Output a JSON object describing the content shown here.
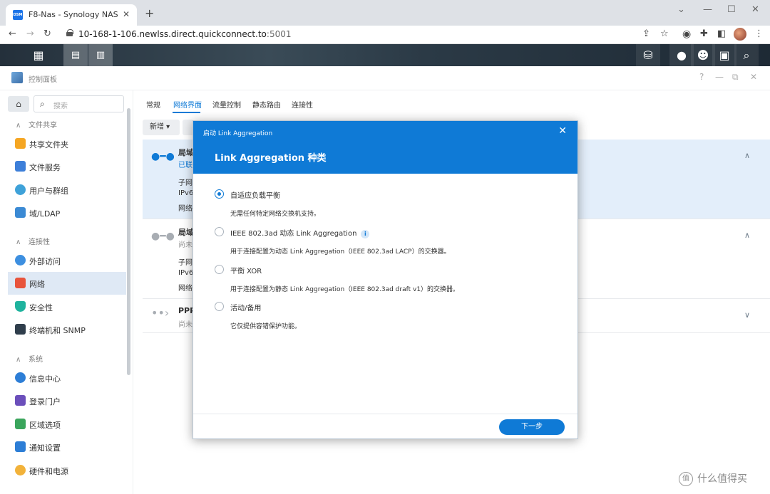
{
  "browser": {
    "tab_title": "F8-Nas - Synology NAS",
    "favicon_text": "DSM",
    "url_host": "10-168-1-106.newlss.direct.quickconnect.to",
    "url_port": ":5001"
  },
  "window": {
    "title": "控制面板",
    "controls": [
      "?",
      "—",
      "⧉",
      "✕"
    ]
  },
  "sidebar": {
    "search_placeholder": "搜索",
    "sections": {
      "file_sharing": "文件共享",
      "connectivity": "连接性",
      "system": "系统"
    },
    "items": [
      {
        "label": "共享文件夹",
        "icon": "shared-folder-icon",
        "color": "#f5a623"
      },
      {
        "label": "文件服务",
        "icon": "file-services-icon",
        "color": "#3d7fd9"
      },
      {
        "label": "用户与群组",
        "icon": "users-groups-icon",
        "color": "#3fa2d9"
      },
      {
        "label": "域/LDAP",
        "icon": "domain-ldap-icon",
        "color": "#3b8ad4"
      },
      {
        "label": "外部访问",
        "icon": "external-access-icon",
        "color": "#3d8fe0"
      },
      {
        "label": "网络",
        "icon": "network-icon",
        "color": "#e8543c"
      },
      {
        "label": "安全性",
        "icon": "security-icon",
        "color": "#1fb39e"
      },
      {
        "label": "终端机和 SNMP",
        "icon": "terminal-snmp-icon",
        "color": "#2f3e4c"
      },
      {
        "label": "信息中心",
        "icon": "info-center-icon",
        "color": "#2d7ed6"
      },
      {
        "label": "登录门户",
        "icon": "login-portal-icon",
        "color": "#6b4fbb"
      },
      {
        "label": "区域选项",
        "icon": "regional-options-icon",
        "color": "#3aa55c"
      },
      {
        "label": "通知设置",
        "icon": "notification-icon",
        "color": "#2d7ed6"
      },
      {
        "label": "硬件和电源",
        "icon": "hardware-power-icon",
        "color": "#f2b23a"
      }
    ]
  },
  "tabs": [
    "常规",
    "网络界面",
    "流量控制",
    "静态路由",
    "连接性"
  ],
  "toolbar": {
    "add_label": "新增 ▾"
  },
  "interfaces": [
    {
      "name": "局域",
      "status": "已联",
      "status_color": "#0f7ad6",
      "lines": [
        "子网",
        "IPv6",
        "网络"
      ]
    },
    {
      "name": "局域",
      "status": "尚未",
      "status_color": "#999999",
      "lines": [
        "子网",
        "IPv6",
        "网络"
      ]
    },
    {
      "name": "PPP",
      "status": "尚未",
      "status_color": "#999999",
      "lines": []
    }
  ],
  "modal": {
    "small_title": "启动 Link Aggregation",
    "title": "Link Aggregation 种类",
    "options": [
      {
        "label": "自适应负载平衡",
        "desc": "无需任何特定网络交换机支持。",
        "checked": true
      },
      {
        "label": "IEEE 802.3ad 动态 Link Aggregation",
        "desc": "用于连接配置为动态 Link Aggregation（IEEE 802.3ad LACP）的交换器。",
        "checked": false,
        "info": "i"
      },
      {
        "label": "平衡 XOR",
        "desc": "用于连接配置为静态 Link Aggregation（IEEE 802.3ad draft v1）的交换器。",
        "checked": false
      },
      {
        "label": "活动/备用",
        "desc": "它仅提供容错保护功能。",
        "checked": false
      }
    ],
    "next_label": "下一步"
  },
  "watermark": "什么值得买",
  "watermark_icon": "值"
}
